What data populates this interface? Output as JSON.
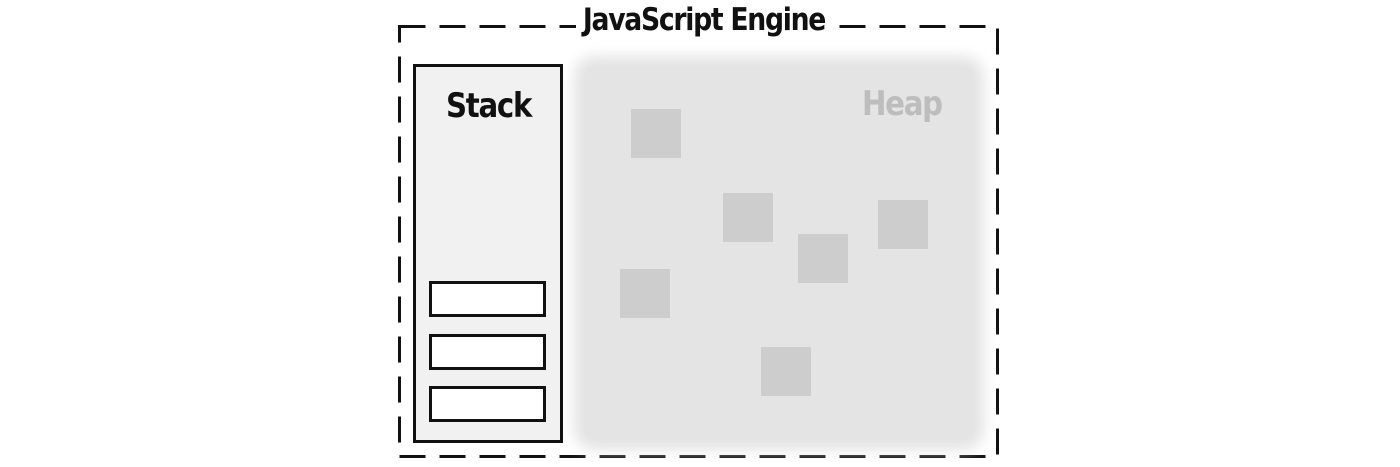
{
  "engine": {
    "title": "JavaScript Engine"
  },
  "stack": {
    "label": "Stack",
    "frame_count": 3
  },
  "heap": {
    "label": "Heap",
    "object_count": 6
  },
  "colors": {
    "stroke": "#111111",
    "stack_fill": "#f1f1f1",
    "heap_fill": "#e4e4e4",
    "heap_object_fill": "#cdcdcd",
    "heap_label": "#bdbdbd"
  }
}
